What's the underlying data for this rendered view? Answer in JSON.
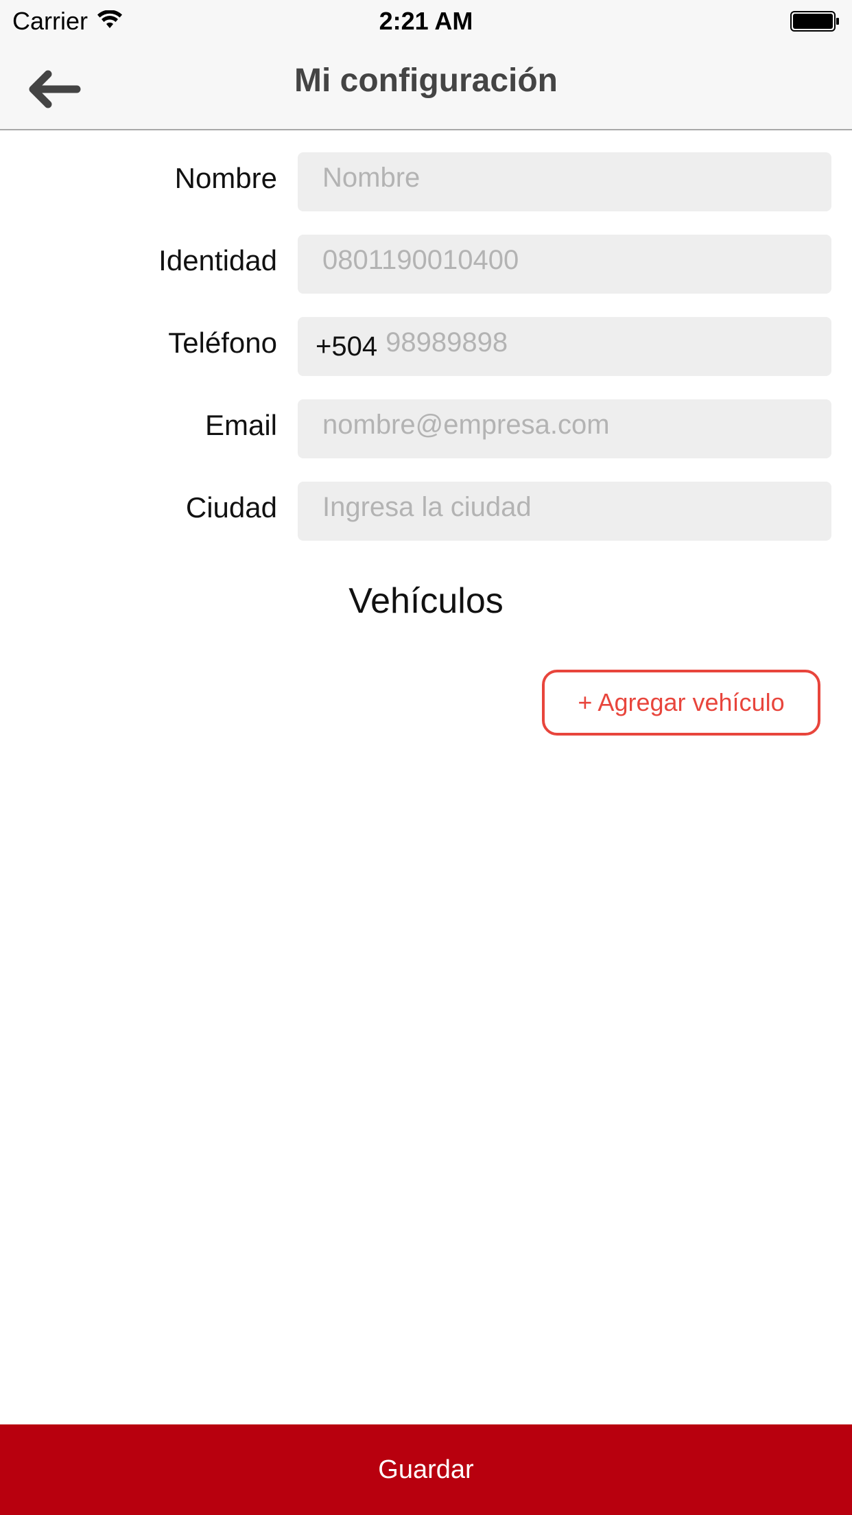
{
  "status_bar": {
    "carrier": "Carrier",
    "time": "2:21 AM"
  },
  "nav": {
    "title": "Mi configuración"
  },
  "form": {
    "fields": [
      {
        "label": "Nombre",
        "value": "",
        "placeholder": "Nombre"
      },
      {
        "label": "Identidad",
        "value": "",
        "placeholder": "0801190010400"
      },
      {
        "label": "Teléfono",
        "prefix": "+504",
        "value": "",
        "placeholder": "98989898"
      },
      {
        "label": "Email",
        "value": "",
        "placeholder": "nombre@empresa.com"
      },
      {
        "label": "Ciudad",
        "value": "",
        "placeholder": "Ingresa la ciudad"
      }
    ]
  },
  "vehicles": {
    "title": "Vehículos",
    "add_button_label": "+ Agregar vehículo"
  },
  "footer": {
    "save_label": "Guardar"
  },
  "colors": {
    "accent": "#e8453c",
    "primary_button": "#b8000e",
    "field_background": "#eeeeee",
    "bar_background": "#f7f7f7"
  }
}
